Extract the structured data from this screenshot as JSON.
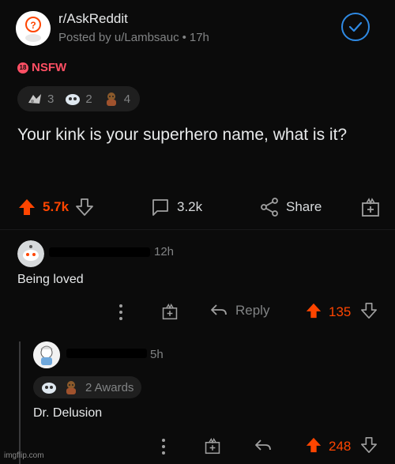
{
  "post": {
    "subreddit": "r/AskReddit",
    "posted_by": "Posted by u/Lambsauc",
    "time_sep": "•",
    "time": "17h",
    "nsfw_badge": "18",
    "nsfw_label": "NSFW",
    "awards": [
      {
        "icon": "award-icon-1",
        "count": "3"
      },
      {
        "icon": "award-icon-2",
        "count": "2"
      },
      {
        "icon": "award-icon-3",
        "count": "4"
      }
    ],
    "title": "Your kink is your superhero name, what is it?",
    "upvotes": "5.7k",
    "comments": "3.2k",
    "share_label": "Share"
  },
  "comments": [
    {
      "time": "12h",
      "text": "Being loved",
      "reply_label": "Reply",
      "score": "135"
    },
    {
      "time": "5h",
      "awards_label": "2 Awards",
      "text": "Dr. Delusion",
      "score": "248"
    }
  ],
  "colors": {
    "upvote": "#ff4500",
    "accent_blue": "#2f8ae4",
    "nsfw": "#ff4f64"
  },
  "watermark": "imgflip.com"
}
